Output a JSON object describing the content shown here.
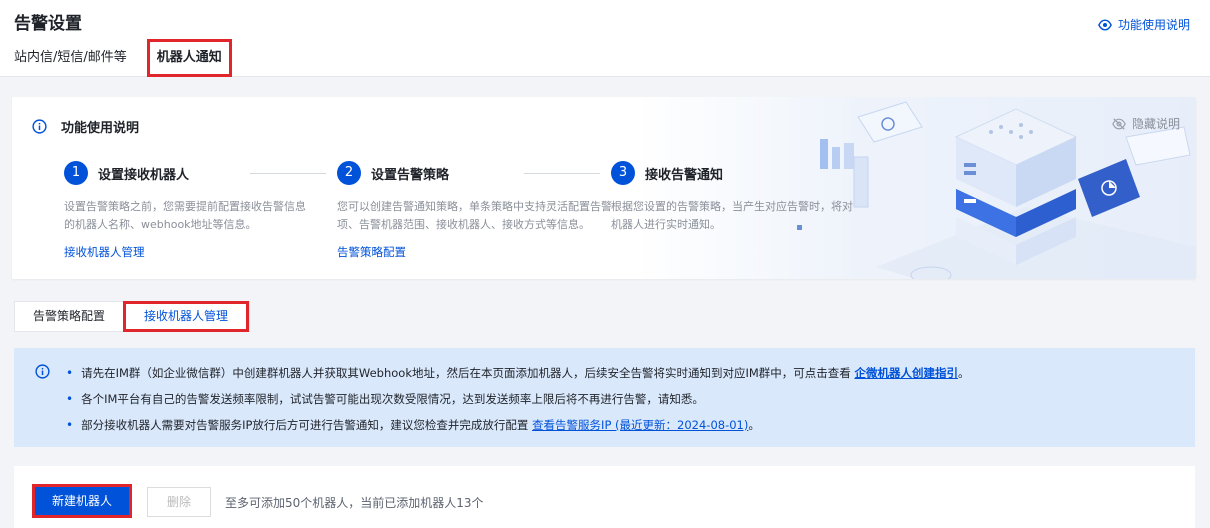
{
  "header": {
    "title": "告警设置",
    "help_link": "功能使用说明",
    "tabs": [
      {
        "label": "站内信/短信/邮件等"
      },
      {
        "label": "机器人通知"
      }
    ]
  },
  "intro": {
    "title": "功能使用说明",
    "hide_label": "隐藏说明",
    "steps": [
      {
        "num": "1",
        "title": "设置接收机器人",
        "desc": "设置告警策略之前，您需要提前配置接收告警信息的机器人名称、webhook地址等信息。",
        "link": "接收机器人管理"
      },
      {
        "num": "2",
        "title": "设置告警策略",
        "desc": "您可以创建告警通知策略，单条策略中支持灵活配置告警项、告警机器范围、接收机器人、接收方式等信息。",
        "link": "告警策略配置"
      },
      {
        "num": "3",
        "title": "接收告警通知",
        "desc": "根据您设置的告警策略，当产生对应告警时，将对机器人进行实时通知。",
        "link": ""
      }
    ]
  },
  "subtabs": [
    {
      "label": "告警策略配置"
    },
    {
      "label": "接收机器人管理"
    }
  ],
  "notice": {
    "line1_text": "请先在IM群（如企业微信群）中创建群机器人并获取其Webhook地址，然后在本页面添加机器人，后续安全告警将实时通知到对应IM群中，可点击查看 ",
    "line1_link": "企微机器人创建指引",
    "line1_end": "。",
    "line2_text": "各个IM平台有自己的告警发送频率限制，试试告警可能出现次数受限情况，达到发送频率上限后将不再进行告警，请知悉。",
    "line3_text": "部分接收机器人需要对告警服务IP放行后方可进行告警通知，建议您检查并完成放行配置 ",
    "line3_link": "查看告警服务IP (最近更新：2024-08-01)",
    "line3_end": "。"
  },
  "panel": {
    "new_button": "新建机器人",
    "delete_button": "删除",
    "hint": "至多可添加50个机器人，当前已添加机器人13个"
  },
  "colors": {
    "accent": "#0052d9",
    "highlight_border": "#e0262b",
    "notice_bg": "#dae8fc"
  }
}
